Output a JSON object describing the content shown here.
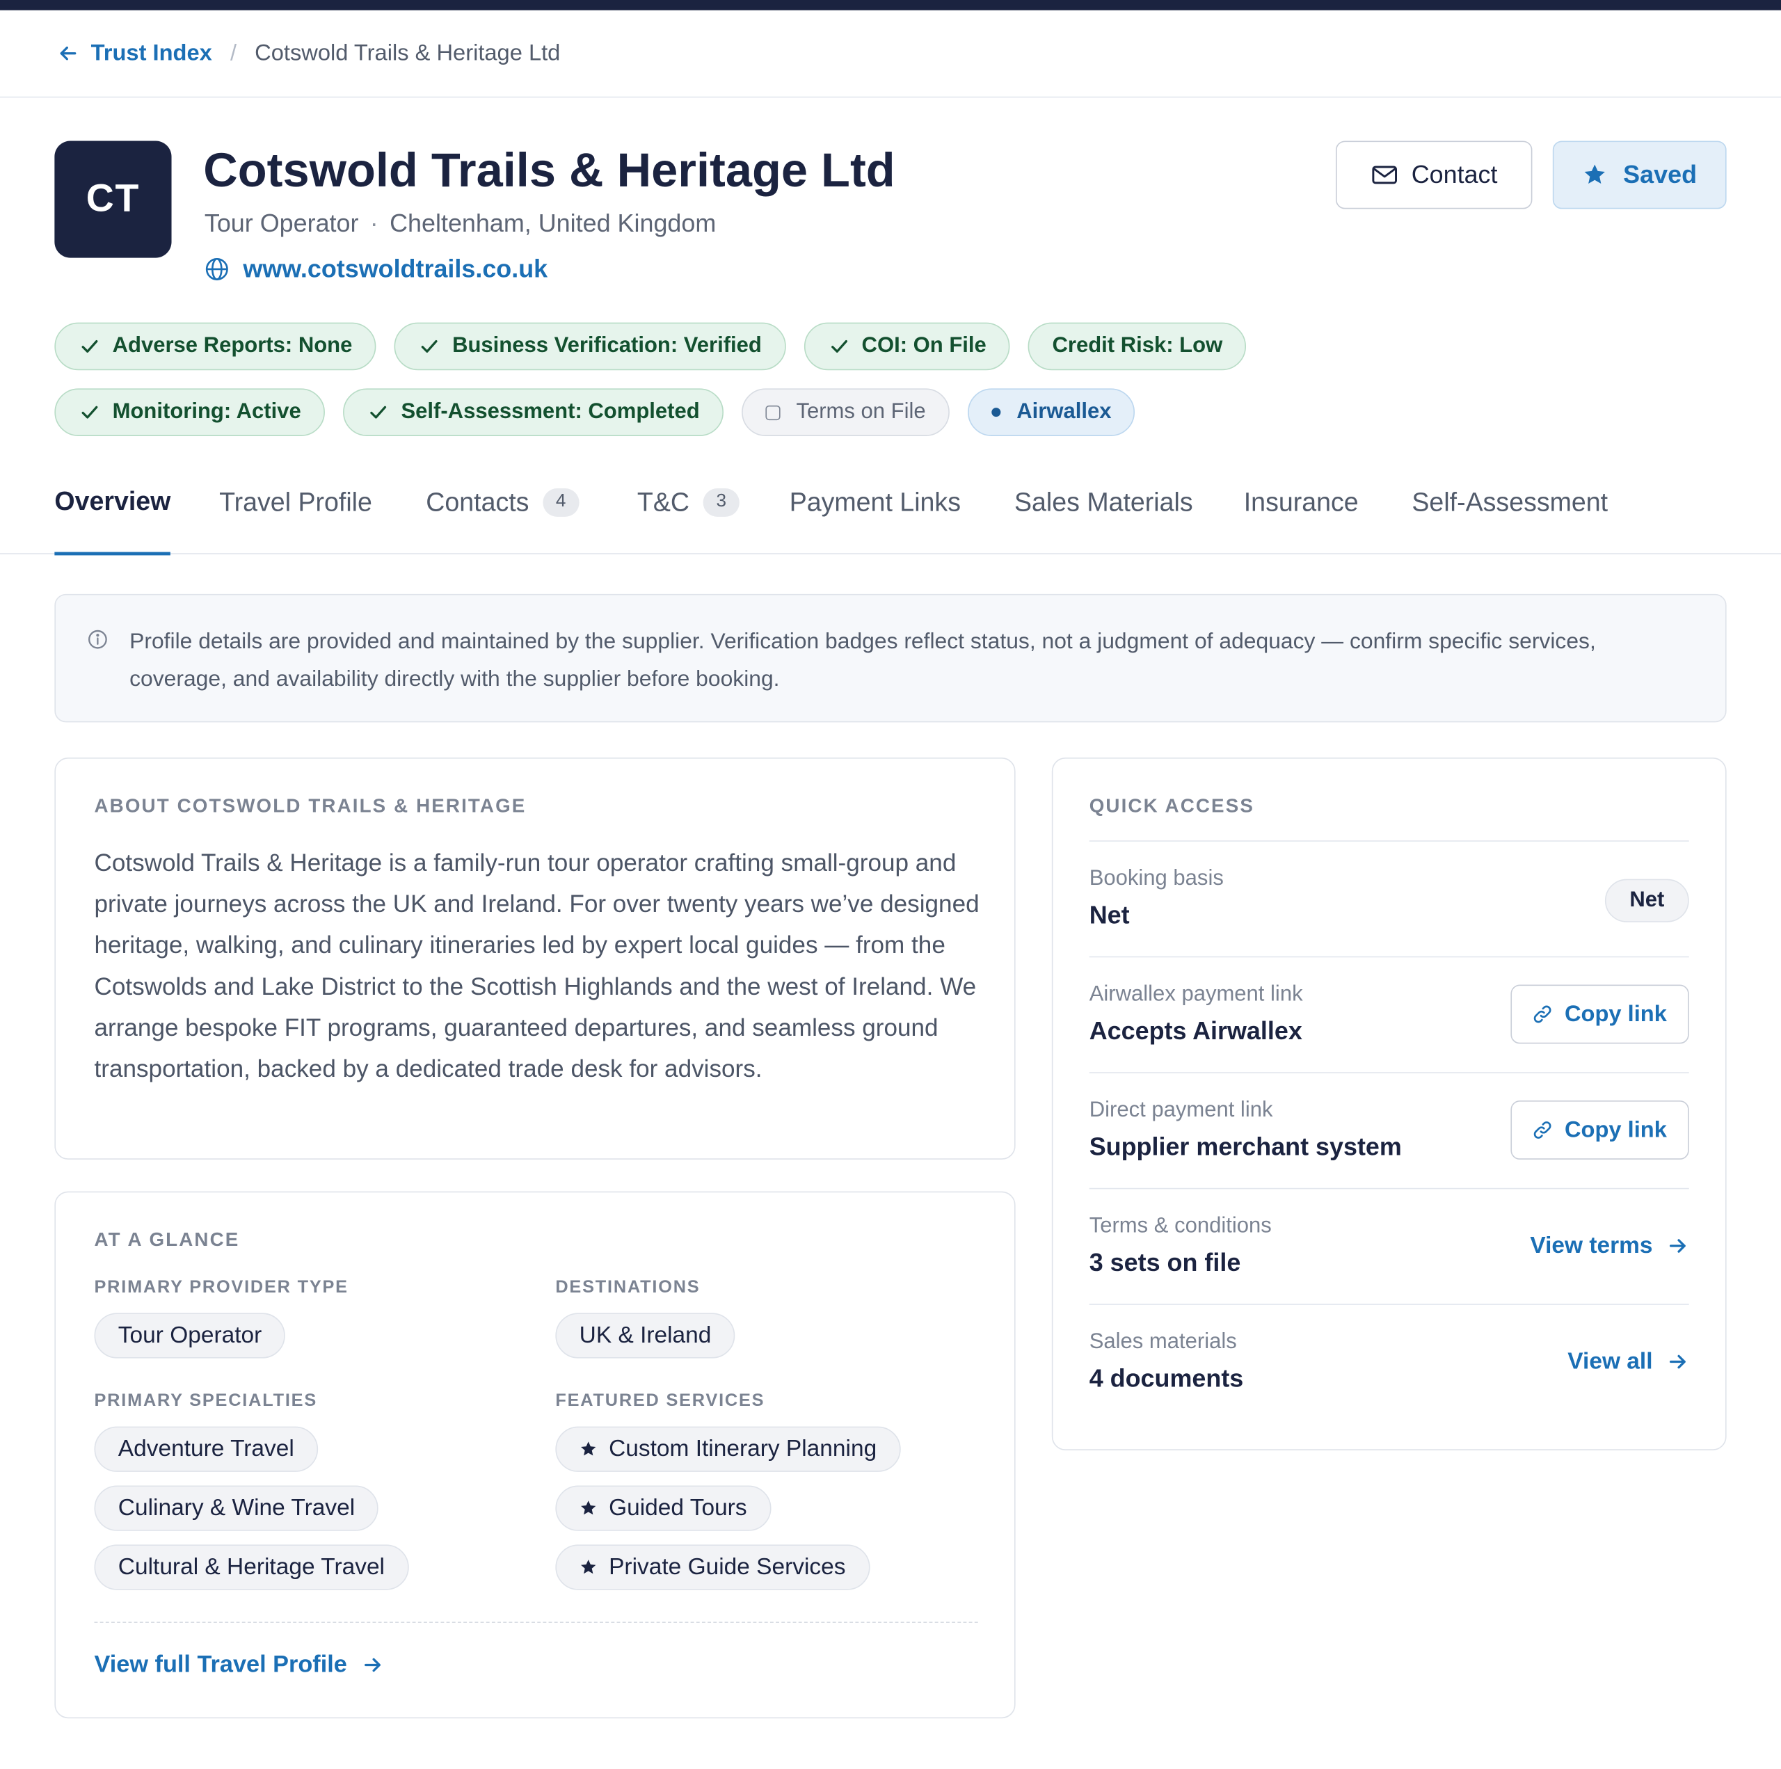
{
  "breadcrumb": {
    "back_label": "Trust Index",
    "separator": "/",
    "current": "Cotswold Trails & Heritage Ltd"
  },
  "header": {
    "logo_initials": "CT",
    "company_name": "Cotswold Trails & Heritage Ltd",
    "provider_type": "Tour Operator",
    "location": "Cheltenham, United Kingdom",
    "website": "www.cotswoldtrails.co.uk",
    "contact_label": "Contact",
    "saved_label": "Saved"
  },
  "badges": {
    "row1": [
      {
        "label": "Adverse Reports: None",
        "style": "green",
        "icon": "check-icon"
      },
      {
        "label": "Business Verification: Verified",
        "style": "green",
        "icon": "check-icon"
      },
      {
        "label": "COI: On File",
        "style": "green",
        "icon": "check-icon"
      },
      {
        "label": "Credit Risk: Low",
        "style": "green",
        "icon": "none"
      }
    ],
    "row2": [
      {
        "label": "Monitoring: Active",
        "style": "green",
        "icon": "check-icon"
      },
      {
        "label": "Self-Assessment: Completed",
        "style": "green",
        "icon": "check-icon"
      },
      {
        "label": "Terms on File",
        "style": "grey",
        "icon": "checkbox-icon"
      },
      {
        "label": "Airwallex",
        "style": "blue",
        "icon": "dot-icon"
      }
    ]
  },
  "tabs": [
    {
      "label": "Overview",
      "active": true
    },
    {
      "label": "Travel Profile"
    },
    {
      "label": "Contacts",
      "count": "4"
    },
    {
      "label": "T&C",
      "count": "3"
    },
    {
      "label": "Payment Links"
    },
    {
      "label": "Sales Materials"
    },
    {
      "label": "Insurance"
    },
    {
      "label": "Self-Assessment"
    }
  ],
  "notice": {
    "text": "Profile details are provided and maintained by the supplier. Verification badges reflect status, not a judgment of adequacy — confirm specific services, coverage, and availability directly with the supplier before booking."
  },
  "about": {
    "heading": "About Cotswold Trails & Heritage",
    "body": "Cotswold Trails & Heritage is a family-run tour operator crafting small-group and private journeys across the UK and Ireland. For over twenty years we’ve designed heritage, walking, and culinary itineraries led by expert local guides — from the Cotswolds and Lake District to the Scottish Highlands and the west of Ireland. We arrange bespoke FIT programs, guaranteed departures, and seamless ground transportation, backed by a dedicated trade desk for advisors."
  },
  "glance": {
    "heading": "At a glance",
    "provider_type_label": "Primary provider type",
    "provider_type_value": "Tour Operator",
    "destinations_label": "Destinations",
    "destinations_value": "UK & Ireland",
    "specialties_label": "Primary specialties",
    "specialties": [
      "Adventure Travel",
      "Culinary & Wine Travel",
      "Cultural & Heritage Travel"
    ],
    "services_label": "Featured services",
    "services": [
      "Custom Itinerary Planning",
      "Guided Tours",
      "Private Guide Services"
    ],
    "more_link": "View full Travel Profile"
  },
  "quick": {
    "heading": "Quick access",
    "booking_label": "Booking basis",
    "booking_value": "Net",
    "booking_pill": "Net",
    "airwallex_label": "Airwallex payment link",
    "airwallex_value": "Accepts Airwallex",
    "direct_label": "Direct payment link",
    "direct_value": "Supplier merchant system",
    "copy_label": "Copy link",
    "terms_label": "Terms & conditions",
    "terms_value": "3 sets on file",
    "terms_link": "View terms",
    "sales_label": "Sales materials",
    "sales_value": "4 documents",
    "sales_link": "View all"
  },
  "colors": {
    "navy": "#1b2340",
    "link_blue": "#1b6fb5",
    "success_green": "#13502f",
    "success_bg": "#e6f4ec"
  }
}
